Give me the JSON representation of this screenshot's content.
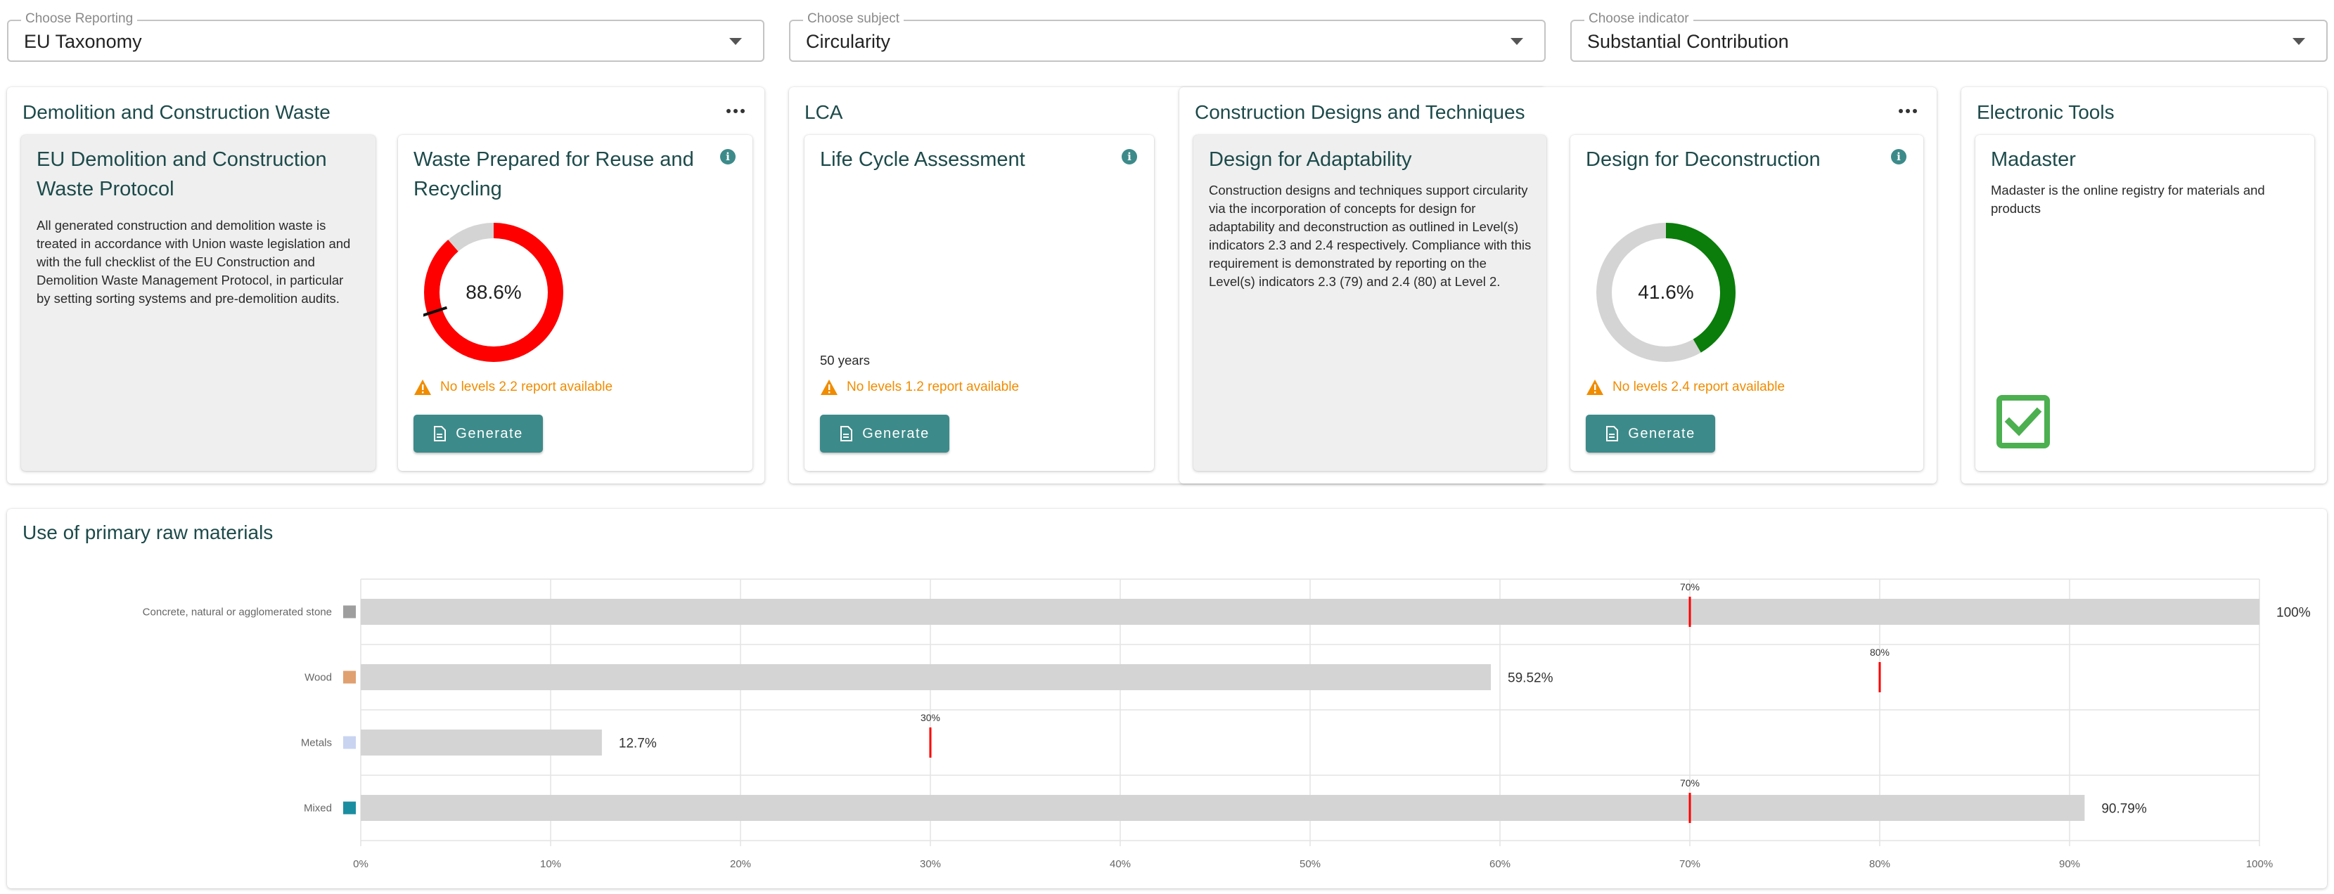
{
  "selectors": [
    {
      "label": "Choose Reporting",
      "value": "EU Taxonomy"
    },
    {
      "label": "Choose subject",
      "value": "Circularity"
    },
    {
      "label": "Choose indicator",
      "value": "Substantial Contribution"
    }
  ],
  "sections": {
    "demolition": {
      "title": "Demolition and Construction Waste",
      "protocol_card": {
        "title": "EU Demolition and Construction Waste Protocol",
        "text": "All generated construction and demolition waste is treated in accordance with Union waste legislation and with the full checklist of the EU Construction and Demolition Waste Management Protocol, in particular by setting sorting systems and pre-demolition audits."
      },
      "reuse_card": {
        "title": "Waste Prepared for Reuse and Recycling",
        "value_label": "88.6%",
        "value": 88.6,
        "threshold": 70,
        "warning": "No levels 2.2 report available",
        "button": "Generate"
      }
    },
    "lca": {
      "title": "LCA",
      "card": {
        "title": "Life Cycle Assessment",
        "years": "50 years",
        "warning": "No levels 1.2 report available",
        "button": "Generate"
      }
    },
    "construction": {
      "title": "Construction Designs and Techniques",
      "adaptability_card": {
        "title": "Design for Adaptability",
        "text": "Construction designs and techniques support circularity via the incorporation of concepts for design for adaptability and deconstruction as outlined in Level(s) indicators 2.3 and 2.4 respectively. Compliance with this requirement is demonstrated by reporting on the Level(s) indicators 2.3 (79) and 2.4 (80) at Level 2."
      },
      "deconstruction_card": {
        "title": "Design for Deconstruction",
        "value_label": "41.6%",
        "value": 41.6,
        "warning": "No levels 2.4 report available",
        "button": "Generate"
      }
    },
    "tools": {
      "title": "Electronic Tools",
      "card": {
        "title": "Madaster",
        "text": "Madaster is the online registry for materials and products",
        "checked": true
      }
    }
  },
  "raw_materials": {
    "title": "Use of primary raw materials"
  },
  "colors": {
    "accent": "#3d8a8a",
    "danger": "#ff0000",
    "success": "#0a7d0a",
    "warning": "#f08c00",
    "track": "#d4d4d4"
  },
  "chart_data": {
    "type": "bar",
    "orientation": "horizontal",
    "categories": [
      "Concrete, natural or agglomerated stone",
      "Wood",
      "Metals",
      "Mixed"
    ],
    "category_colors": [
      "#9e9e9e",
      "#e0a070",
      "#c8d4f0",
      "#1a8ea0"
    ],
    "values": [
      100,
      59.52,
      12.7,
      90.79
    ],
    "value_labels": [
      "100%",
      "59.52%",
      "12.7%",
      "90.79%"
    ],
    "targets": [
      70,
      80,
      30,
      70
    ],
    "target_labels": [
      "70%",
      "80%",
      "30%",
      "70%"
    ],
    "xlim": [
      0,
      100
    ],
    "xticks": [
      "0%",
      "10%",
      "20%",
      "30%",
      "40%",
      "50%",
      "60%",
      "70%",
      "80%",
      "90%",
      "100%"
    ],
    "grid": true,
    "title": "",
    "xlabel": "",
    "ylabel": ""
  }
}
